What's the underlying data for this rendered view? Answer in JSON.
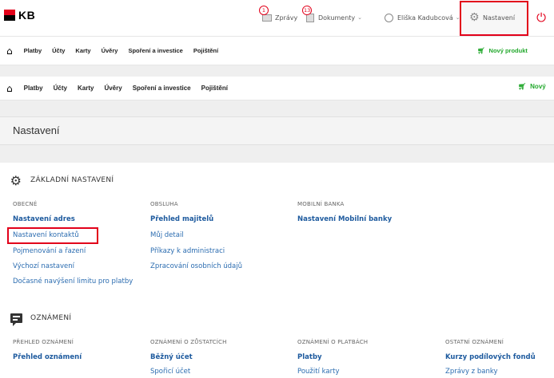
{
  "brand": {
    "logo_text": "KB",
    "accent": "#e2001a",
    "green": "#22a82c",
    "link_color": "#2b6cb0"
  },
  "topbar": {
    "messages": {
      "label": "Zprávy",
      "count": "1",
      "icon": "envelope-icon"
    },
    "documents": {
      "label": "Dokumenty",
      "count": "13",
      "icon": "document-icon"
    },
    "user": {
      "label": "Eliška Kadubcová",
      "icon": "user-icon"
    },
    "settings": {
      "label": "Nastavení",
      "icon": "gear-icon"
    },
    "logout_icon": "power-icon"
  },
  "nav": {
    "items": [
      "Platby",
      "Účty",
      "Karty",
      "Úvěry",
      "Spoření a investice",
      "Pojištění"
    ],
    "new_product_short": "Nový produkt",
    "new_product_cut": "Nový"
  },
  "page": {
    "title": "Nastavení"
  },
  "basic": {
    "title": "ZÁKLADNÍ NASTAVENÍ",
    "columns": [
      {
        "header": "OBECNÉ",
        "links": [
          "Nastavení adres",
          "Nastavení kontaktů",
          "Pojmenování a řazení",
          "Výchozí nastavení",
          "Dočasné navýšení limitu pro platby"
        ]
      },
      {
        "header": "OBSLUHA",
        "links": [
          "Přehled majitelů",
          "Můj detail",
          "Příkazy k administraci",
          "Zpracování osobních údajů"
        ]
      },
      {
        "header": "MOBILNÍ BANKA",
        "links": [
          "Nastavení Mobilní banky"
        ]
      }
    ]
  },
  "notifications": {
    "title": "OZNÁMENÍ",
    "columns": [
      {
        "header": "PŘEHLED OZNÁMENÍ",
        "links": [
          "Přehled oznámení"
        ]
      },
      {
        "header": "OZNÁMENÍ O ZŮSTATCÍCH",
        "links": [
          "Běžný účet",
          "Spořicí účet"
        ]
      },
      {
        "header": "OZNÁMENÍ O PLATBÁCH",
        "links": [
          "Platby",
          "Použití karty"
        ]
      },
      {
        "header": "OSTATNÍ OZNÁMENÍ",
        "links": [
          "Kurzy podílových fondů",
          "Zprávy z banky"
        ]
      }
    ]
  }
}
